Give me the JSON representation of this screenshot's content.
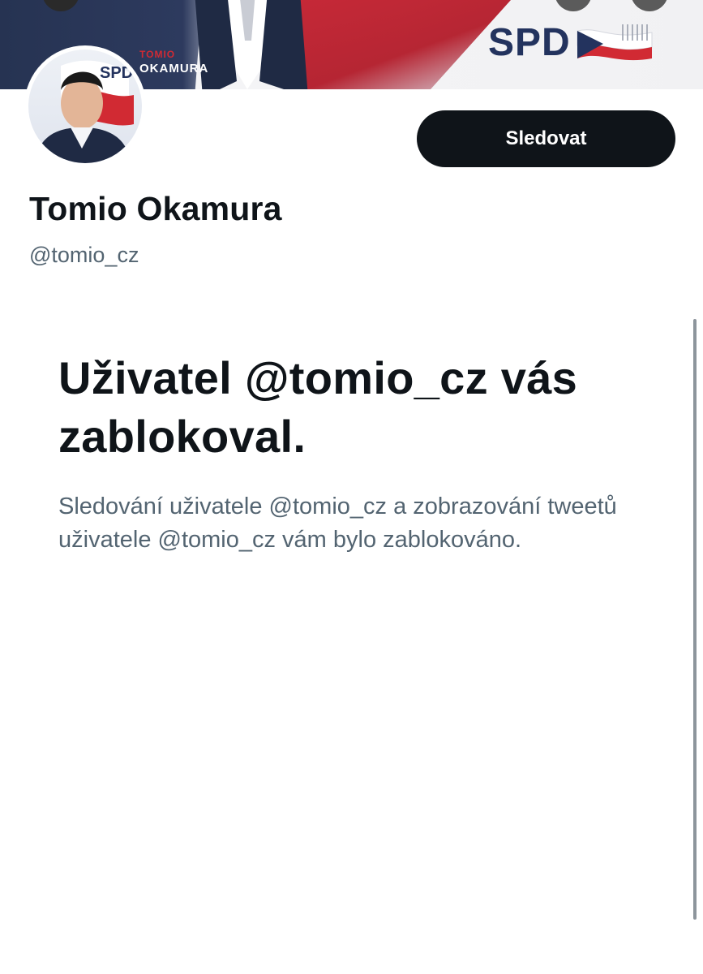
{
  "banner": {
    "name_top": "TOMIO",
    "name_bottom": "OKAMURA",
    "logo_text": "SPD"
  },
  "avatar": {
    "badge_text": "SPD"
  },
  "profile": {
    "display_name": "Tomio Okamura",
    "handle": "@tomio_cz",
    "follow_label": "Sledovat"
  },
  "blocked": {
    "title": "Uživatel @tomio_cz vás zablokoval.",
    "description": "Sledování uživatele @tomio_cz a zobrazování tweetů uživatele @tomio_cz vám bylo zablokováno."
  },
  "colors": {
    "button_bg": "#0f1419",
    "text_primary": "#0f1419",
    "text_secondary": "#536471",
    "spd_blue": "#23335e",
    "spd_red": "#d12a33"
  }
}
